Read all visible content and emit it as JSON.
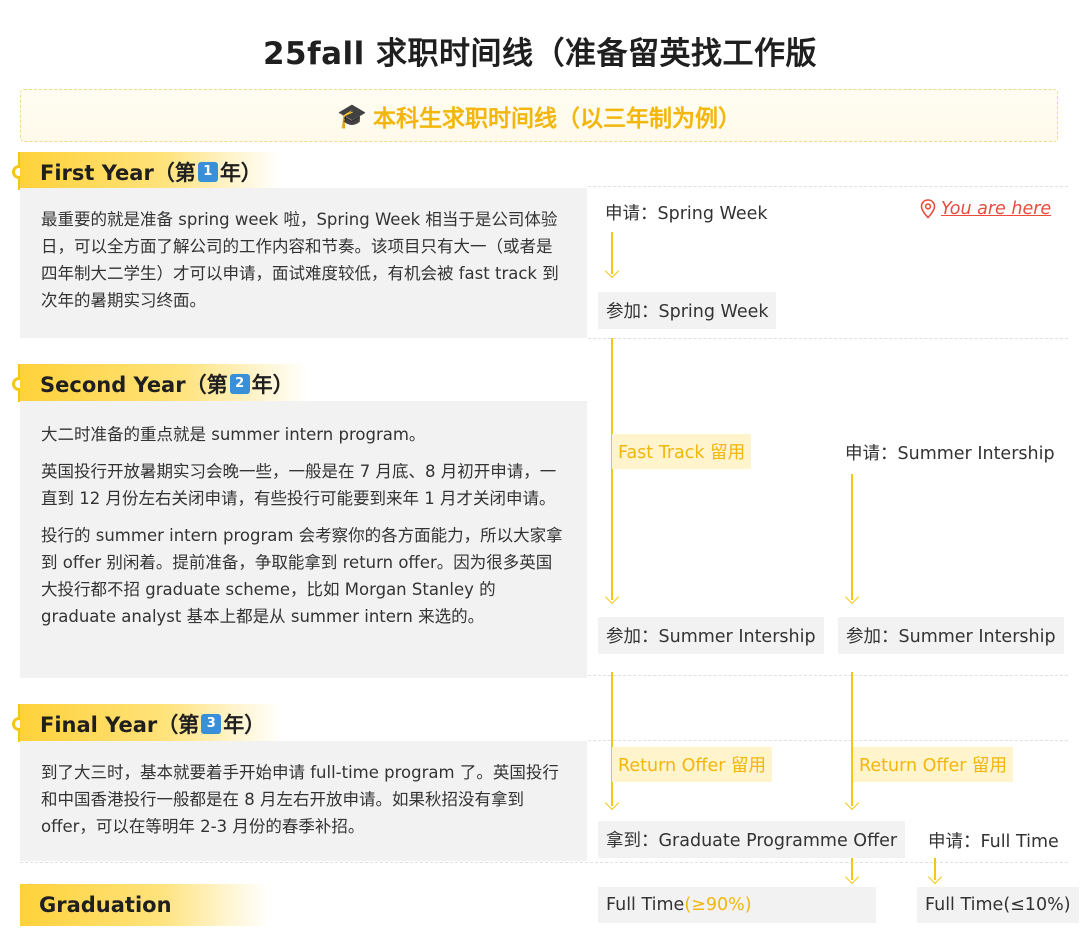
{
  "title": "25fall 求职时间线（准备留英找工作版",
  "subtitle": "本科生求职时间线（以三年制为例）",
  "years": [
    {
      "label_prefix": "First Year（第",
      "num": "1",
      "label_suffix": "年）",
      "desc": [
        "最重要的就是准备 spring week 啦，Spring Week 相当于是公司体验日，可以全方面了解公司的工作内容和节奏。该项目只有大一（或者是四年制大二学生）才可以申请，面试难度较低，有机会被 fast track 到次年的暑期实习终面。"
      ]
    },
    {
      "label_prefix": "Second Year（第",
      "num": "2",
      "label_suffix": "年）",
      "desc": [
        "大二时准备的重点就是 summer intern program。",
        "英国投行开放暑期实习会晚一些，一般是在 7 月底、8 月初开申请，一直到 12 月份左右关闭申请，有些投行可能要到来年 1 月才关闭申请。",
        "投行的 summer intern program 会考察你的各方面能力，所以大家拿到 offer 别闲着。提前准备，争取能拿到 return offer。因为很多英国大投行都不招 graduate scheme，比如 Morgan Stanley 的 graduate analyst 基本上都是从 summer intern 来选的。"
      ]
    },
    {
      "label_prefix": "Final Year（第",
      "num": "3",
      "label_suffix": "年）",
      "desc": [
        "到了大三时，基本就要着手开始申请 full-time program 了。英国投行和中国香港投行一般都是在 8 月左右开放申请。如果秋招没有拿到 offer，可以在等明年 2-3 月份的春季补招。"
      ]
    }
  ],
  "graduation": "Graduation",
  "timeline": {
    "you_are_here": "You are here",
    "apply_spring": "申请：Spring Week",
    "join_spring": "参加：Spring Week",
    "fast_track": "Fast Track 留用",
    "apply_summer": "申请：Summer Intership",
    "join_summer_left": "参加：Summer Intership",
    "join_summer_right": "参加：Summer Intership",
    "return_offer_left": "Return Offer 留用",
    "return_offer_right": "Return Offer 留用",
    "get_offer": "拿到：Graduate Programme Offer",
    "apply_fulltime": "申请：Full Time",
    "fulltime_left_label": "Full Time",
    "fulltime_left_pct": "(≥90%)",
    "fulltime_right": "Full Time(≤10%)"
  },
  "colors": {
    "accent": "#f5c518",
    "accent_text": "#f2b60c",
    "here": "#e84c3d",
    "box": "#f2f2f2"
  },
  "icons": [
    "graduation-cap-icon",
    "location-pin-icon"
  ]
}
